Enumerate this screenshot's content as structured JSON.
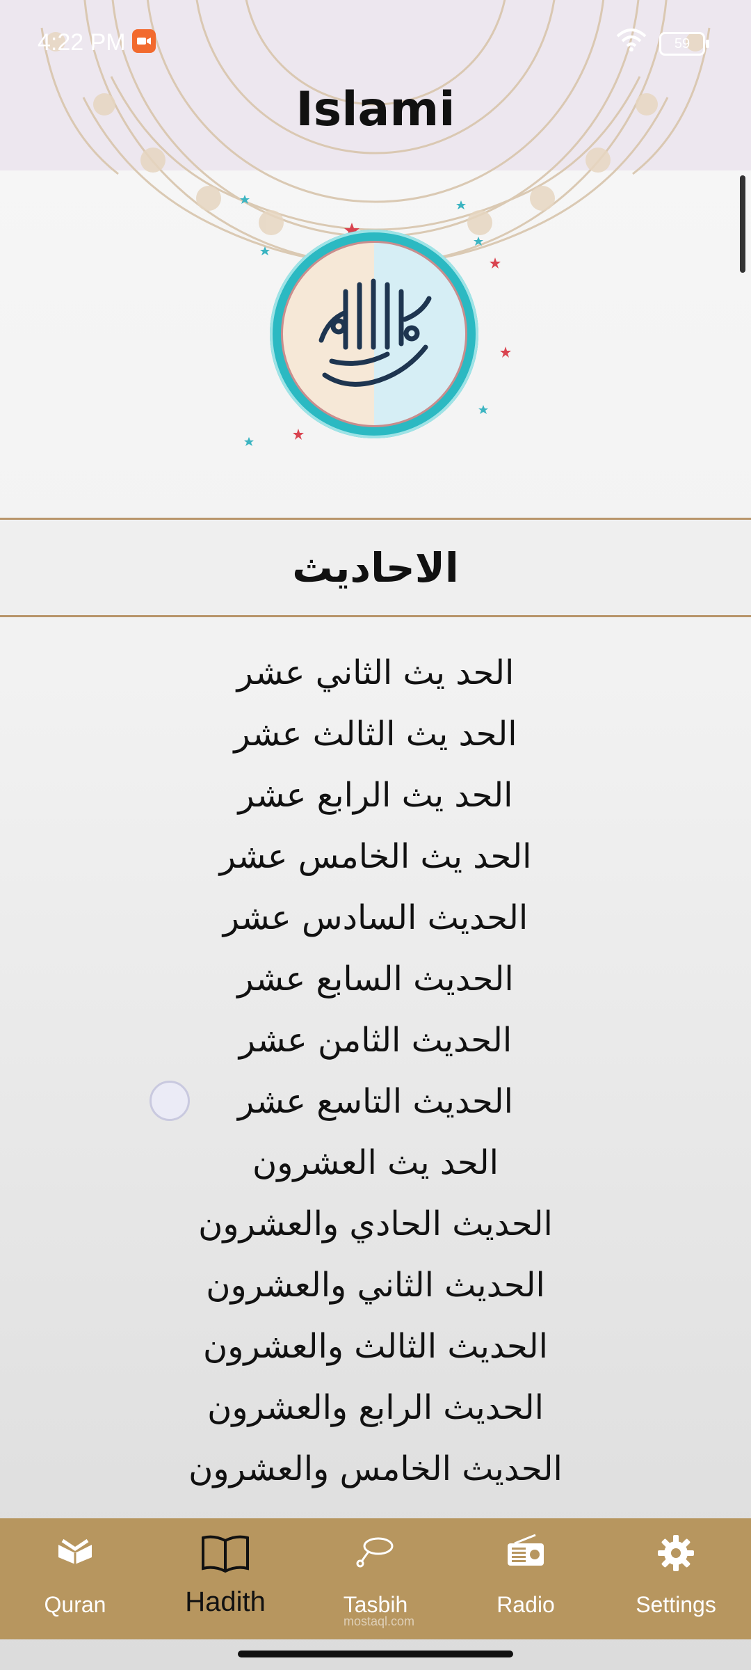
{
  "status_bar": {
    "time": "4:22 PM",
    "battery": "59"
  },
  "app": {
    "title": "Islami"
  },
  "section": {
    "title": "الاحاديث"
  },
  "hadith_list": [
    "الحد يث الثاني عشر",
    "الحد يث الثالث عشر",
    "الحد يث الرابع عشر",
    "الحد يث الخامس عشر",
    "الحديث السادس عشر",
    "الحديث السابع عشر",
    "الحديث الثامن عشر",
    "الحديث التاسع عشر",
    "الحد يث العشرون",
    "الحديث الحادي والعشرون",
    "الحديث الثاني والعشرون",
    "الحديث الثالث والعشرون",
    "الحديث الرابع والعشرون",
    "الحديث الخامس والعشرون"
  ],
  "bottom_nav": {
    "items": [
      {
        "label": "Quran",
        "icon": "quran-book-icon",
        "active": false
      },
      {
        "label": "Hadith",
        "icon": "open-book-icon",
        "active": true
      },
      {
        "label": "Tasbih",
        "icon": "tasbih-beads-icon",
        "active": false
      },
      {
        "label": "Radio",
        "icon": "radio-icon",
        "active": false
      },
      {
        "label": "Settings",
        "icon": "gear-icon",
        "active": false
      }
    ]
  },
  "watermark": "mostaql.com",
  "colors": {
    "nav_bg": "#b7965f",
    "divider": "#b8956a",
    "logo_ring": "#2bb9c2"
  }
}
